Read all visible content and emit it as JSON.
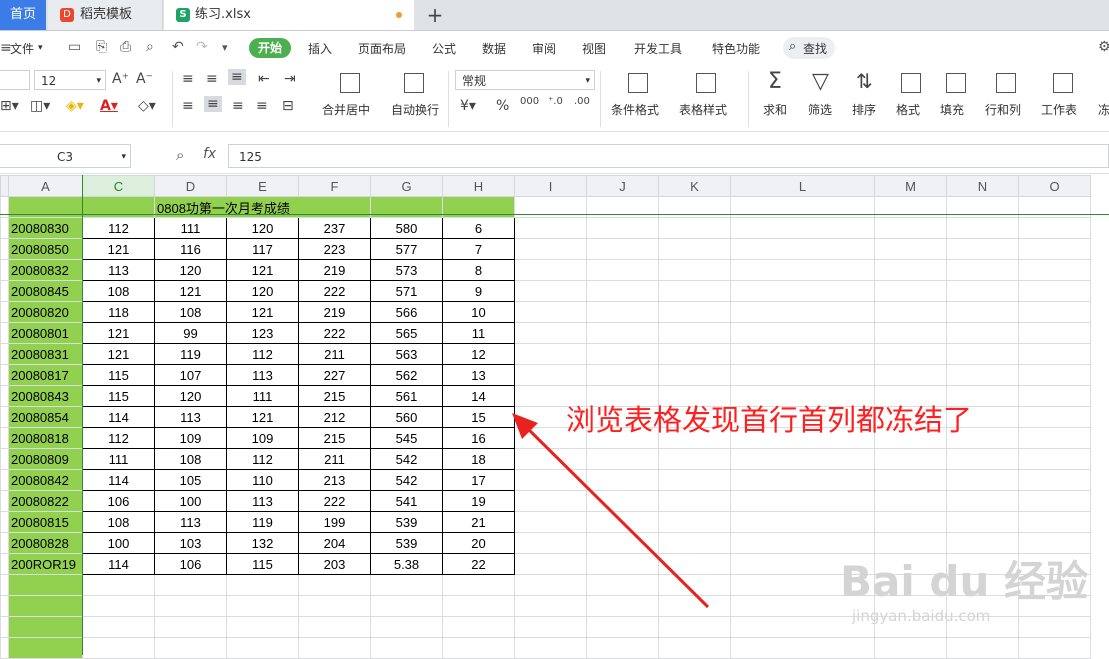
{
  "tabs": {
    "home": "首页",
    "template": "稻壳模板",
    "file": "练习.xlsx"
  },
  "menu": {
    "file": "文件",
    "start": "开始",
    "insert": "插入",
    "layout": "页面布局",
    "formula": "公式",
    "data": "数据",
    "review": "审阅",
    "view": "视图",
    "dev": "开发工具",
    "special": "特色功能",
    "search": "查找"
  },
  "ribbon": {
    "font_size": "12",
    "number_format": "常规",
    "merge_center": "合并居中",
    "auto_wrap": "自动换行",
    "cond_format": "条件格式",
    "table_style": "表格样式",
    "sum": "求和",
    "filter": "筛选",
    "sort": "排序",
    "format": "格式",
    "fill": "填充",
    "row_col": "行和列",
    "worksheet": "工作表",
    "freeze": "冻"
  },
  "formula_bar": {
    "cell_ref": "C3",
    "fx": "fx",
    "value": "125"
  },
  "columns": [
    "A",
    "C",
    "D",
    "E",
    "F",
    "G",
    "H",
    "I",
    "J",
    "K",
    "L",
    "M",
    "N",
    "O"
  ],
  "sheet": {
    "title": "0808功第一次月考成绩",
    "rows": [
      [
        "20080830",
        "112",
        "111",
        "120",
        "237",
        "580",
        "6"
      ],
      [
        "20080850",
        "121",
        "116",
        "117",
        "223",
        "577",
        "7"
      ],
      [
        "20080832",
        "113",
        "120",
        "121",
        "219",
        "573",
        "8"
      ],
      [
        "20080845",
        "108",
        "121",
        "120",
        "222",
        "571",
        "9"
      ],
      [
        "20080820",
        "118",
        "108",
        "121",
        "219",
        "566",
        "10"
      ],
      [
        "20080801",
        "121",
        "99",
        "123",
        "222",
        "565",
        "11"
      ],
      [
        "20080831",
        "121",
        "119",
        "112",
        "211",
        "563",
        "12"
      ],
      [
        "20080817",
        "115",
        "107",
        "113",
        "227",
        "562",
        "13"
      ],
      [
        "20080843",
        "115",
        "120",
        "111",
        "215",
        "561",
        "14"
      ],
      [
        "20080854",
        "114",
        "113",
        "121",
        "212",
        "560",
        "15"
      ],
      [
        "20080818",
        "112",
        "109",
        "109",
        "215",
        "545",
        "16"
      ],
      [
        "20080809",
        "111",
        "108",
        "112",
        "211",
        "542",
        "18"
      ],
      [
        "20080842",
        "114",
        "105",
        "110",
        "213",
        "542",
        "17"
      ],
      [
        "20080822",
        "106",
        "100",
        "113",
        "222",
        "541",
        "19"
      ],
      [
        "20080815",
        "108",
        "113",
        "119",
        "199",
        "539",
        "21"
      ],
      [
        "20080828",
        "100",
        "103",
        "132",
        "204",
        "539",
        "20"
      ],
      [
        "200ROR19",
        "114",
        "106",
        "115",
        "203",
        "5.38",
        "22"
      ]
    ]
  },
  "annotation": "浏览表格发现首行首列都冻结了",
  "watermark": {
    "brand": "Bai du 经验",
    "url": "jingyan.baidu.com"
  },
  "colors": {
    "accent_green": "#4caf50",
    "cell_green": "#92d050",
    "annotation_red": "#ff1f1f",
    "tab_blue": "#3c7ce6"
  }
}
